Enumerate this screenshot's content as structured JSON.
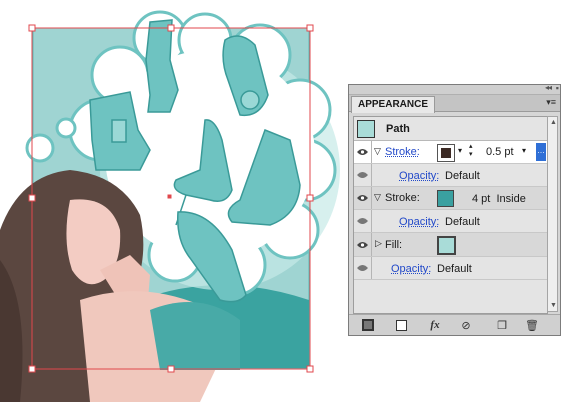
{
  "panel": {
    "tab_label": "APPEARANCE",
    "collapse_icon": "double-arrow-icon",
    "menu_icon": "panel-menu-icon",
    "header": {
      "title": "Path"
    },
    "stroke1": {
      "label": "Stroke:",
      "weight": "0.5 pt",
      "color": "#3d2b25"
    },
    "opacity1": {
      "label": "Opacity:",
      "value": "Default"
    },
    "stroke2": {
      "label": "Stroke:",
      "detail": "4 pt  Inside",
      "color": "#3aa0a0"
    },
    "opacity2": {
      "label": "Opacity:",
      "value": "Default"
    },
    "fill": {
      "label": "Fill:",
      "color": "#a9dcd8"
    },
    "opacity3": {
      "label": "Opacity:",
      "value": "Default"
    },
    "footer_icons": [
      "add-stroke-icon",
      "add-fill-icon",
      "fx-icon",
      "clear-appearance-icon",
      "duplicate-item-icon",
      "trash-icon"
    ]
  },
  "colors": {
    "selection": "#e0474c",
    "teal_bg": "#9fd4d2",
    "shoe": "#6ec3c1",
    "highlight_row": "#ffffff"
  }
}
